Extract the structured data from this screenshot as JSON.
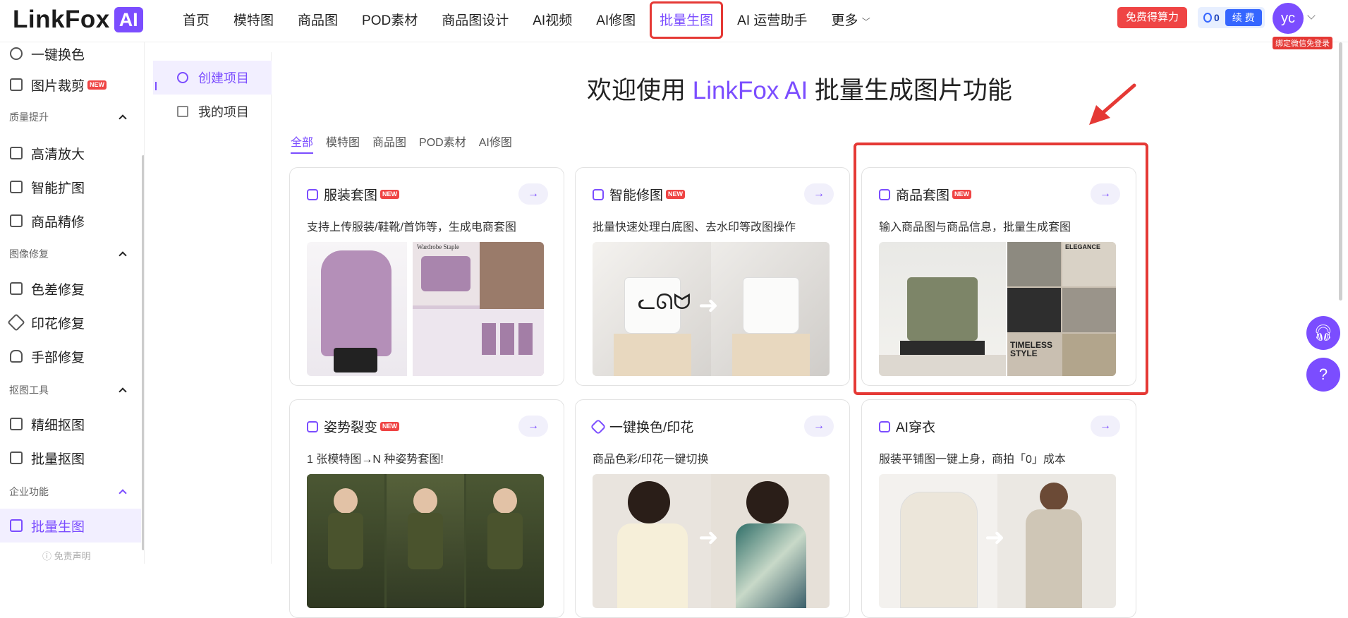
{
  "header": {
    "logo_text": "LinkFox",
    "logo_badge": "AI",
    "nav": [
      {
        "label": "首页"
      },
      {
        "label": "模特图"
      },
      {
        "label": "商品图"
      },
      {
        "label": "POD素材"
      },
      {
        "label": "商品图设计"
      },
      {
        "label": "AI视频"
      },
      {
        "label": "AI修图"
      },
      {
        "label": "批量生图"
      },
      {
        "label": "AI 运营助手"
      },
      {
        "label": "更多"
      }
    ],
    "active_nav": "批量生图",
    "free_button": "免费得算力",
    "points": "0",
    "renew_button": "续 费",
    "avatar_initials": "yc",
    "bind_tag": "绑定微信免登录"
  },
  "sidebar": {
    "items": [
      {
        "label": "一键换色"
      },
      {
        "label": "图片裁剪",
        "badge": "NEW"
      },
      {
        "label": "高清放大"
      },
      {
        "label": "智能扩图"
      },
      {
        "label": "商品精修"
      },
      {
        "label": "色差修复"
      },
      {
        "label": "印花修复"
      },
      {
        "label": "手部修复"
      },
      {
        "label": "精细抠图"
      },
      {
        "label": "批量抠图"
      },
      {
        "label": "批量生图"
      }
    ],
    "groups": [
      {
        "label": "质量提升"
      },
      {
        "label": "图像修复"
      },
      {
        "label": "抠图工具"
      },
      {
        "label": "企业功能"
      }
    ],
    "disclaimer": "ⓘ 免责声明"
  },
  "projects": {
    "create": "创建项目",
    "mine": "我的项目"
  },
  "main": {
    "title_prefix": "欢迎使用",
    "title_brand": "LinkFox AI",
    "title_suffix": "批量生成图片功能",
    "filters": [
      "全部",
      "模特图",
      "商品图",
      "POD素材",
      "AI修图"
    ],
    "active_filter": "全部",
    "cards": [
      {
        "title": "服装套图",
        "badge": "NEW",
        "desc": "支持上传服装/鞋靴/首饰等，生成电商套图",
        "img_text": "Wardrobe Staple"
      },
      {
        "title": "智能修图",
        "badge": "NEW",
        "desc": "批量快速处理白底图、去水印等改图操作"
      },
      {
        "title": "商品套图",
        "badge": "NEW",
        "desc": "输入商品图与商品信息，批量生成套图",
        "img_text_1": "ELEGANCE",
        "img_text_2": "TIMELESS STYLE"
      },
      {
        "title": "姿势裂变",
        "badge": "NEW",
        "desc": "1 张模特图→N 种姿势套图!"
      },
      {
        "title": "一键换色/印花",
        "desc": "商品色彩/印花一键切换"
      },
      {
        "title": "AI穿衣",
        "desc": "服装平铺图一键上身，商拍「0」成本"
      }
    ]
  },
  "colors": {
    "brand": "#7b4dff",
    "highlight": "#e53935"
  }
}
